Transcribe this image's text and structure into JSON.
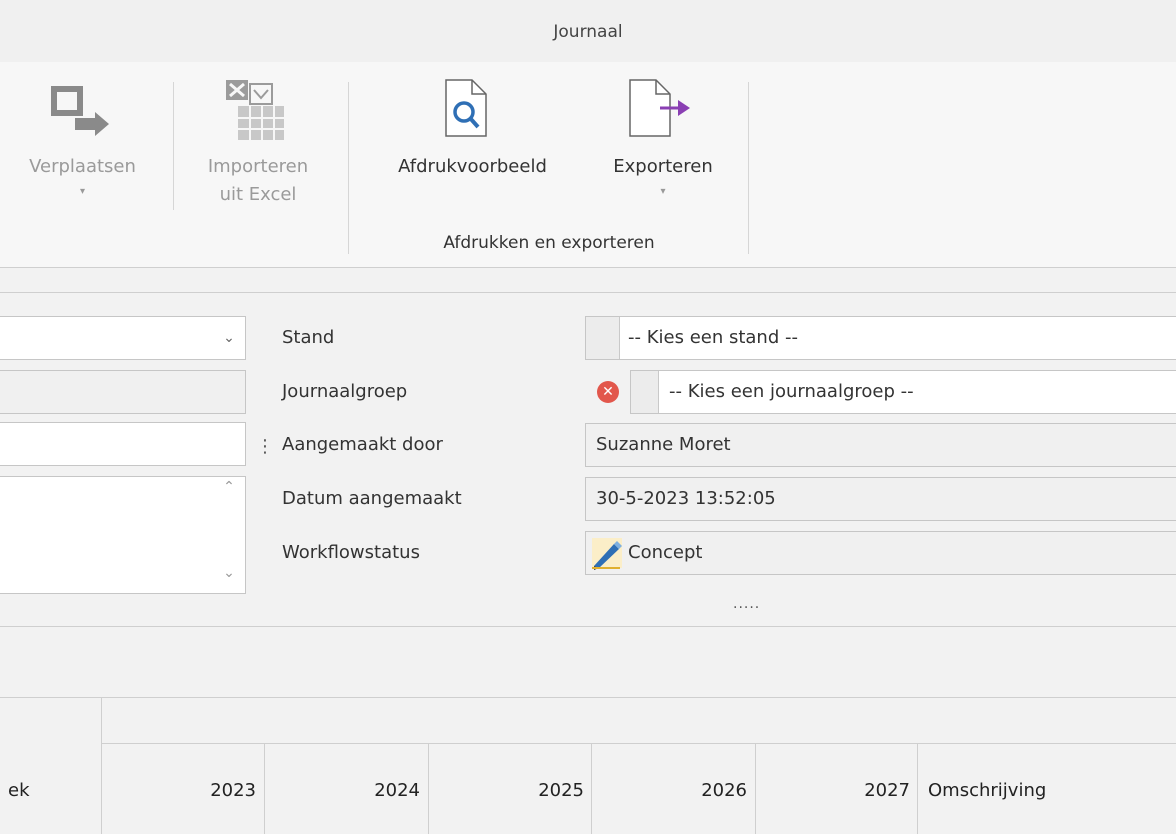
{
  "window": {
    "title": "Journaal"
  },
  "ribbon": {
    "move_label": "Verplaatsen",
    "import_label_1": "Importeren",
    "import_label_2": "uit Excel",
    "preview_label": "Afdrukvoorbeeld",
    "export_label": "Exporteren",
    "group_label": "Afdrukken en exporteren"
  },
  "form": {
    "stand_label": "Stand",
    "stand_value": "-- Kies een stand --",
    "group_label": "Journaalgroep",
    "group_value": "-- Kies een journaalgroep --",
    "created_by_label": "Aangemaakt door",
    "created_by_value": "Suzanne Moret",
    "created_date_label": "Datum aangemaakt",
    "created_date_value": "30-5-2023 13:52:05",
    "status_label": "Workflowstatus",
    "status_value": "Concept",
    "more": "....."
  },
  "grid": {
    "columns": [
      "ek",
      "2023",
      "2024",
      "2025",
      "2026",
      "2027",
      "Omschrijving"
    ]
  },
  "colors": {
    "error": "#e2574c",
    "accent_purple": "#8a3fb3",
    "preview_blue": "#2f6fb5"
  }
}
